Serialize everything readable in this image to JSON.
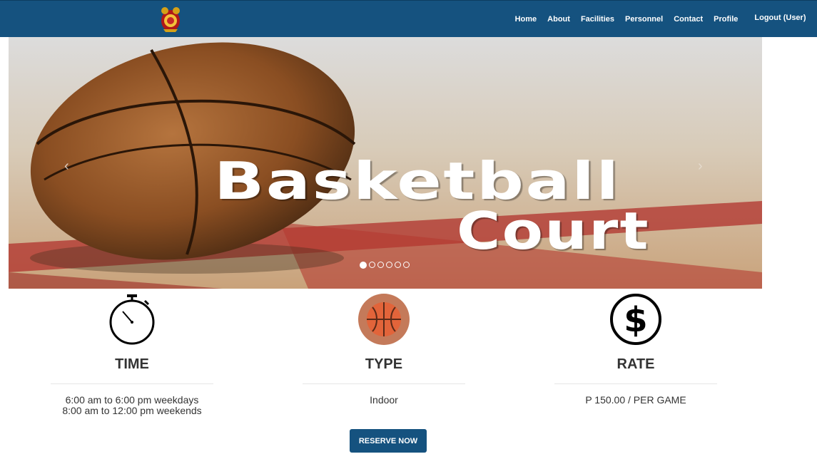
{
  "navbar": {
    "logo_icon": "seal-logo-icon",
    "links": [
      "Home",
      "About",
      "Facilities",
      "Personnel",
      "Contact",
      "Profile"
    ],
    "logout": "Logout (User)",
    "bg_color": "#15527f"
  },
  "carousel": {
    "title_line1": "Basketball",
    "title_line2": "Court",
    "slide_count": 6,
    "active_slide": 1,
    "prev_icon": "chevron-left-icon",
    "next_icon": "chevron-right-icon"
  },
  "features": {
    "time": {
      "icon": "stopwatch-icon",
      "title": "TIME",
      "line1": "6:00 am to 6:00 pm weekdays",
      "line2": "8:00 am to 12:00 pm weekends"
    },
    "type": {
      "icon": "basketball-icon",
      "title": "TYPE",
      "line1": "Indoor"
    },
    "rate": {
      "icon": "dollar-icon",
      "title": "RATE",
      "line1": "P 150.00 / PER GAME"
    }
  },
  "reserve_label": "RESERVE NOW"
}
